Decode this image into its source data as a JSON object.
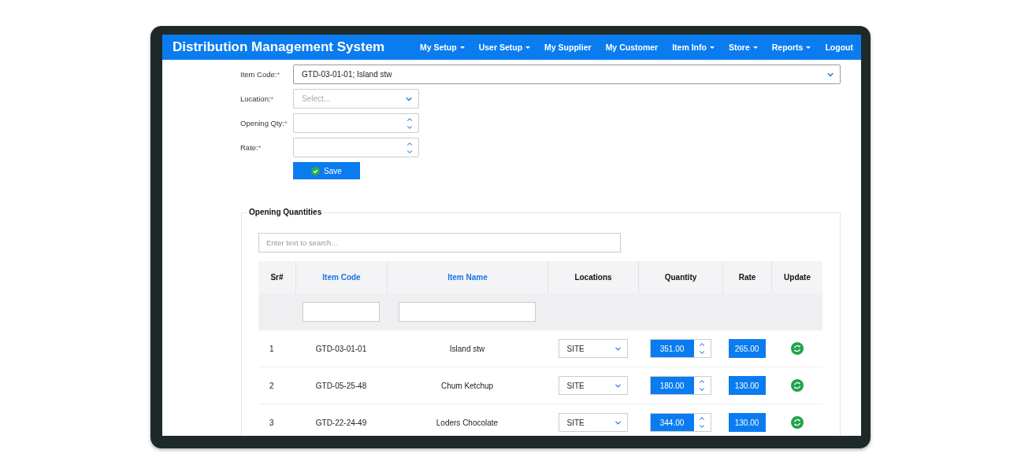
{
  "app": {
    "title": "Distribution Management System"
  },
  "nav": [
    {
      "label": "My Setup",
      "dropdown": true
    },
    {
      "label": "User Setup",
      "dropdown": true
    },
    {
      "label": "My Supplier",
      "dropdown": false
    },
    {
      "label": "My Customer",
      "dropdown": false
    },
    {
      "label": "Item Info",
      "dropdown": true
    },
    {
      "label": "Store",
      "dropdown": true
    },
    {
      "label": "Reports",
      "dropdown": true
    },
    {
      "label": "Logout",
      "dropdown": false
    }
  ],
  "form": {
    "fields": [
      {
        "kind": "select",
        "label": "Item Code:",
        "mark": "*",
        "value": "GTD-03-01-01; Island stw",
        "wide": true
      },
      {
        "kind": "select",
        "label": "Location:",
        "mark": "*",
        "placeholder": "Select...",
        "wide": false
      },
      {
        "kind": "number",
        "label": "Opening Qty:",
        "mark": "*",
        "wide": false
      },
      {
        "kind": "number",
        "label": "Rate:",
        "mark": "*",
        "wide": false
      }
    ],
    "save_button": "Save"
  },
  "panel": {
    "title": "Opening Quantities",
    "search": {
      "placeholder": "Enter text to search..."
    },
    "table": {
      "columns": [
        {
          "label": "Sr#",
          "sortable": false,
          "filter": false
        },
        {
          "label": "Item Code",
          "sortable": true,
          "filter": true
        },
        {
          "label": "Item Name",
          "sortable": true,
          "filter": true
        },
        {
          "label": "Locations",
          "sortable": false,
          "filter": false
        },
        {
          "label": "Quantity",
          "sortable": false,
          "filter": false
        },
        {
          "label": "Rate",
          "sortable": false,
          "filter": false
        },
        {
          "label": "Update",
          "sortable": false,
          "filter": false
        }
      ],
      "rows": [
        {
          "sr": "1",
          "code": "GTD-03-01-01",
          "name": "Island stw",
          "location": "SITE",
          "quantity": "351.00",
          "rate": "265.00"
        },
        {
          "sr": "2",
          "code": "GTD-05-25-48",
          "name": "Chum Ketchup",
          "location": "SITE",
          "quantity": "180.00",
          "rate": "130.00"
        },
        {
          "sr": "3",
          "code": "GTD-22-24-49",
          "name": "Loders Chocolate",
          "location": "SITE",
          "quantity": "344.00",
          "rate": "130.00"
        }
      ]
    }
  }
}
